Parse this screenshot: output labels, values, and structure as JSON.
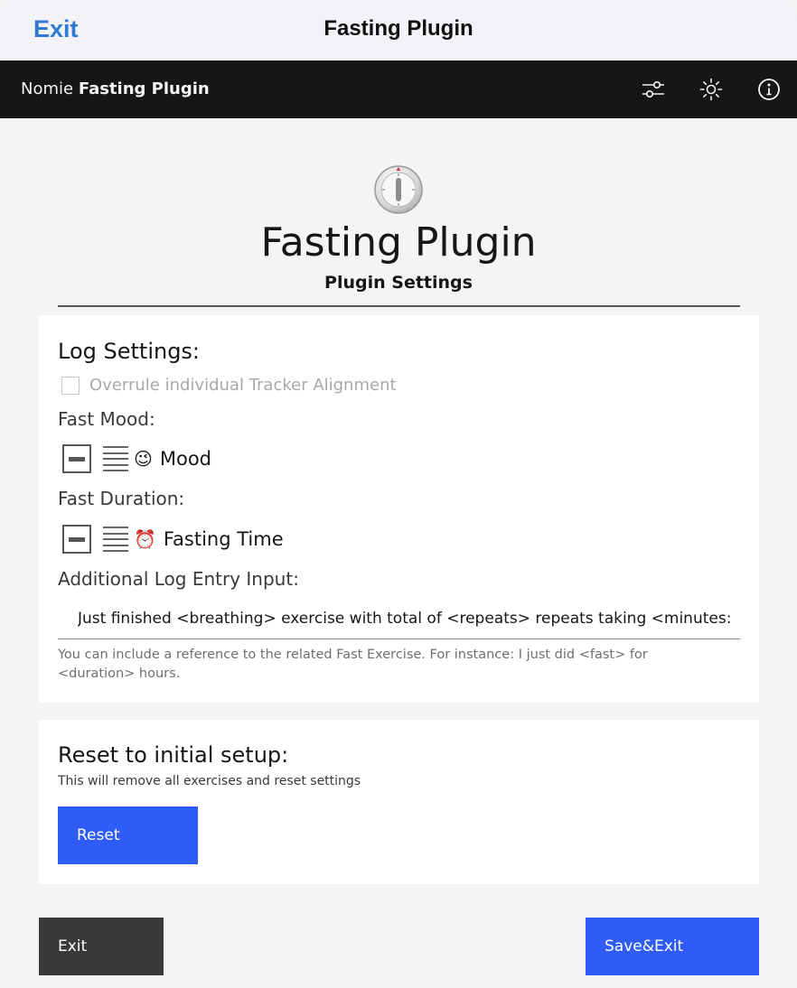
{
  "sheet": {
    "exit_label": "Exit",
    "title": "Fasting Plugin"
  },
  "app_bar": {
    "brand_prefix": "Nomie",
    "brand_name": "Fasting Plugin",
    "icons": [
      "sliders-icon",
      "sun-icon",
      "info-icon"
    ]
  },
  "hero": {
    "icon": "timer-clock-icon",
    "title": "Fasting Plugin",
    "subtitle": "Plugin Settings"
  },
  "log_settings": {
    "title": "Log Settings:",
    "overrule_label": "Overrule individual Tracker Alignment",
    "overrule_checked": false,
    "fast_mood_label": "Fast Mood:",
    "fast_mood_tracker": {
      "emoji": "😉",
      "name": "Mood"
    },
    "fast_duration_label": "Fast Duration:",
    "fast_duration_tracker": {
      "emoji": "⏰",
      "name": "Fasting Time"
    },
    "additional_label": "Additional Log Entry Input:",
    "additional_value": "Just finished <breathing> exercise with total of <repeats> repeats taking <minutes:",
    "helper_text": "You can include a reference to the related Fast Exercise. For instance: I just did <fast> for <duration> hours."
  },
  "reset_section": {
    "title": "Reset to initial setup:",
    "description": "This will remove all exercises and reset settings",
    "button_label": "Reset"
  },
  "footer": {
    "exit_label": "Exit",
    "save_label": "Save&Exit"
  },
  "colors": {
    "accent_blue": "#2f5cf6",
    "link_blue": "#2f7ad6",
    "app_bar_bg": "#161616",
    "exit_button_bg": "#393939"
  }
}
